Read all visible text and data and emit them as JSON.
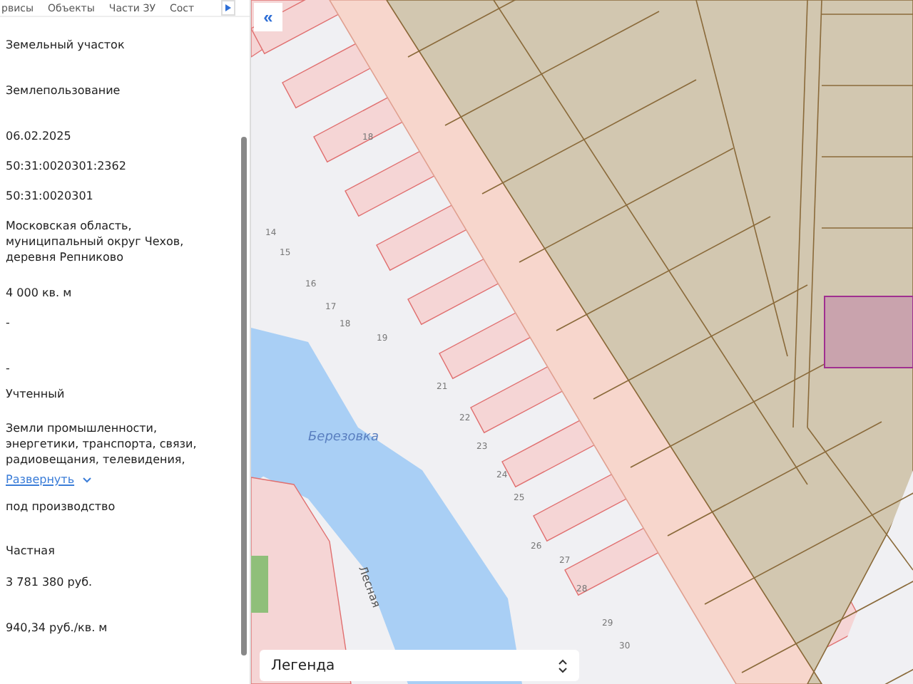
{
  "panel": {
    "tabs": [
      {
        "label": "рвисы"
      },
      {
        "label": "Объекты"
      },
      {
        "label": "Части ЗУ"
      },
      {
        "label": "Сост"
      }
    ],
    "fields": [
      {
        "kind": "text",
        "value": "Земельный участок"
      },
      {
        "kind": "text",
        "value": "Землепользование"
      },
      {
        "kind": "text",
        "value": "06.02.2025"
      },
      {
        "kind": "text",
        "value": "50:31:0020301:2362"
      },
      {
        "kind": "text",
        "value": "50:31:0020301"
      },
      {
        "kind": "text",
        "value": "Московская область, муниципальный округ Чехов, деревня Репниково"
      },
      {
        "kind": "text",
        "value": "4 000 кв. м"
      },
      {
        "kind": "text",
        "value": "-"
      },
      {
        "kind": "text",
        "value": "-"
      },
      {
        "kind": "text",
        "value": "Учтенный"
      },
      {
        "kind": "text",
        "value": "Земли промышленности, энергетики, транспорта, связи, радиовещания, телевидения,"
      },
      {
        "kind": "link",
        "value": "Развернуть"
      },
      {
        "kind": "text",
        "value": "под производство"
      },
      {
        "kind": "text",
        "value": "Частная"
      },
      {
        "kind": "text",
        "value": "3 781 380 руб."
      },
      {
        "kind": "text",
        "value": "940,34 руб./кв. м"
      }
    ]
  },
  "map": {
    "collapse_button": "«",
    "river_label": "Березовка",
    "street_label": "Лесная",
    "house_numbers": [
      "18",
      "14",
      "15",
      "16",
      "17",
      "18",
      "19",
      "21",
      "22",
      "23",
      "24",
      "25",
      "26",
      "27",
      "28",
      "29",
      "30"
    ],
    "legend": {
      "label": "Легенда"
    }
  }
}
